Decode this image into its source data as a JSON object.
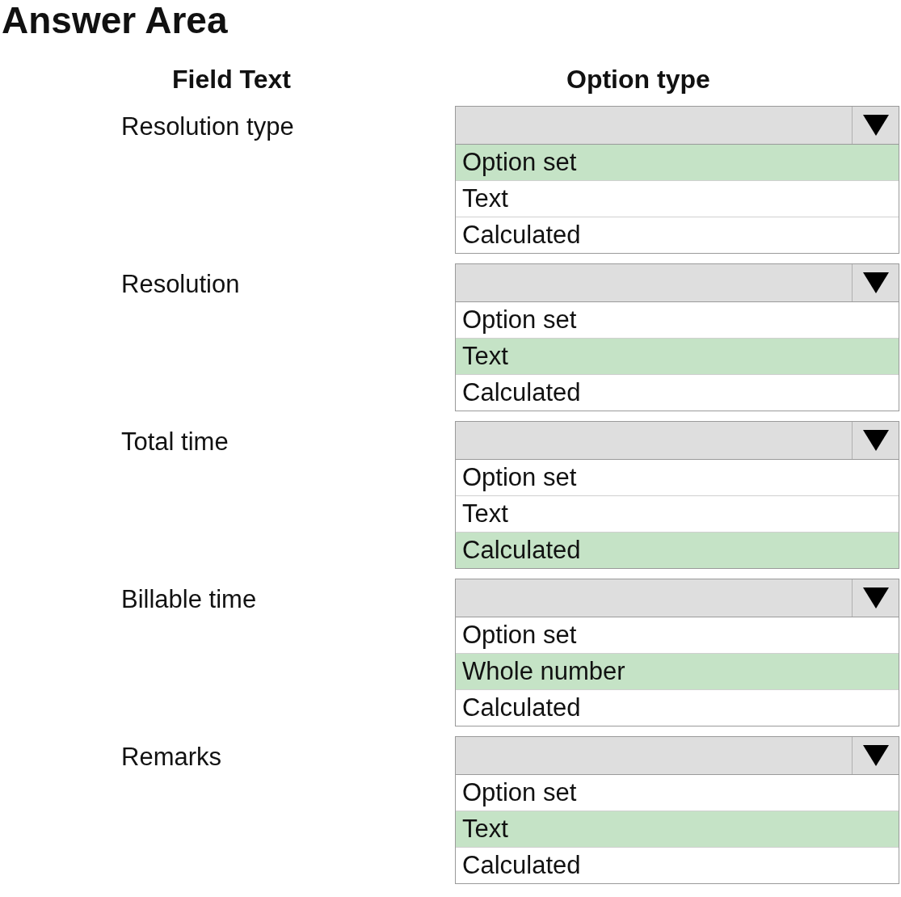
{
  "title": "Answer Area",
  "headers": {
    "field": "Field Text",
    "option": "Option type"
  },
  "rows": [
    {
      "field": "Resolution type",
      "options": [
        {
          "label": "Option set",
          "selected": true
        },
        {
          "label": "Text",
          "selected": false
        },
        {
          "label": "Calculated",
          "selected": false
        }
      ]
    },
    {
      "field": "Resolution",
      "options": [
        {
          "label": "Option set",
          "selected": false
        },
        {
          "label": "Text",
          "selected": true
        },
        {
          "label": "Calculated",
          "selected": false
        }
      ]
    },
    {
      "field": "Total time",
      "options": [
        {
          "label": "Option set",
          "selected": false
        },
        {
          "label": "Text",
          "selected": false
        },
        {
          "label": "Calculated",
          "selected": true
        }
      ]
    },
    {
      "field": "Billable time",
      "options": [
        {
          "label": "Option set",
          "selected": false
        },
        {
          "label": "Whole number",
          "selected": true
        },
        {
          "label": "Calculated",
          "selected": false
        }
      ]
    },
    {
      "field": "Remarks",
      "options": [
        {
          "label": "Option set",
          "selected": false
        },
        {
          "label": "Text",
          "selected": true
        },
        {
          "label": "Calculated",
          "selected": false
        }
      ]
    }
  ]
}
